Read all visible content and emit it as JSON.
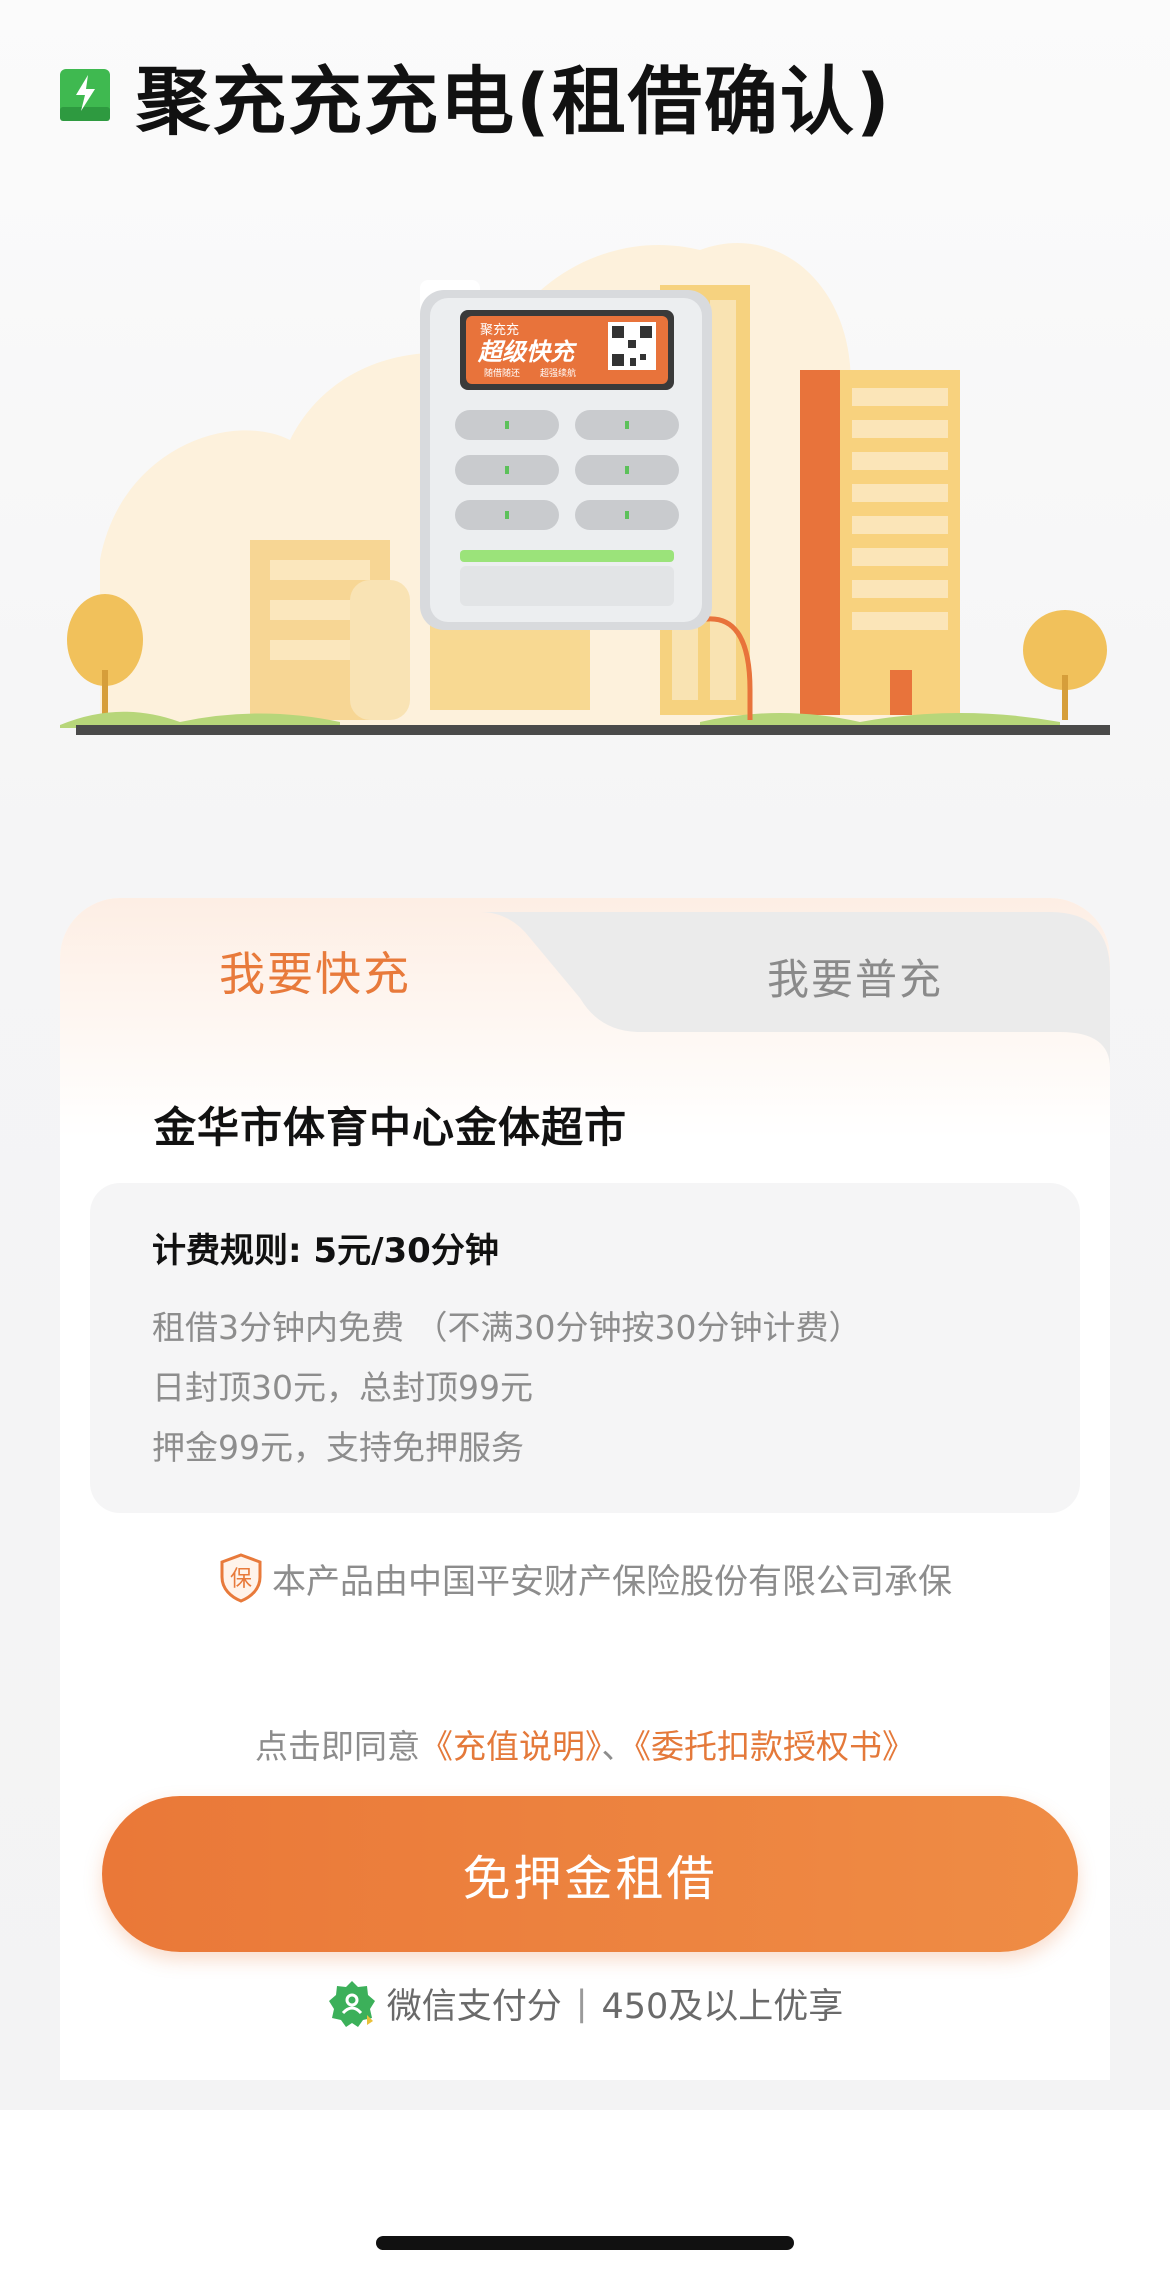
{
  "header": {
    "title": "聚充充充电(租借确认)",
    "icon": "battery-bolt-icon",
    "icon_color": "#3fb950"
  },
  "illustration": {
    "machine_brand": "聚充充",
    "machine_slogan": "超级快充",
    "machine_sub_left": "随借随还",
    "machine_sub_right": "超强续航"
  },
  "tabs": [
    {
      "label": "我要快充",
      "active": true
    },
    {
      "label": "我要普充",
      "active": false
    }
  ],
  "store": {
    "name": "金华市体育中心金体超市"
  },
  "pricing": {
    "title": "计费规则: 5元/30分钟",
    "lines": [
      "租借3分钟内免费 （不满30分钟按30分钟计费）",
      "日封顶30元，总封顶99元",
      "押金99元，支持免押服务"
    ]
  },
  "insurance": {
    "icon_text": "保",
    "text": "本产品由中国平安财产保险股份有限公司承保"
  },
  "agreement": {
    "prefix": "点击即同意",
    "link1": "《充值说明》",
    "separator": "、",
    "link2": "《委托扣款授权书》"
  },
  "primary_button": {
    "label": "免押金租借"
  },
  "wechat": {
    "label": "微信支付分",
    "divider": "|",
    "note": "450及以上优享"
  },
  "colors": {
    "accent": "#e87a3b",
    "button_start": "#ea7838",
    "button_end": "#ef8c45",
    "wechat_green": "#3cb05a"
  }
}
